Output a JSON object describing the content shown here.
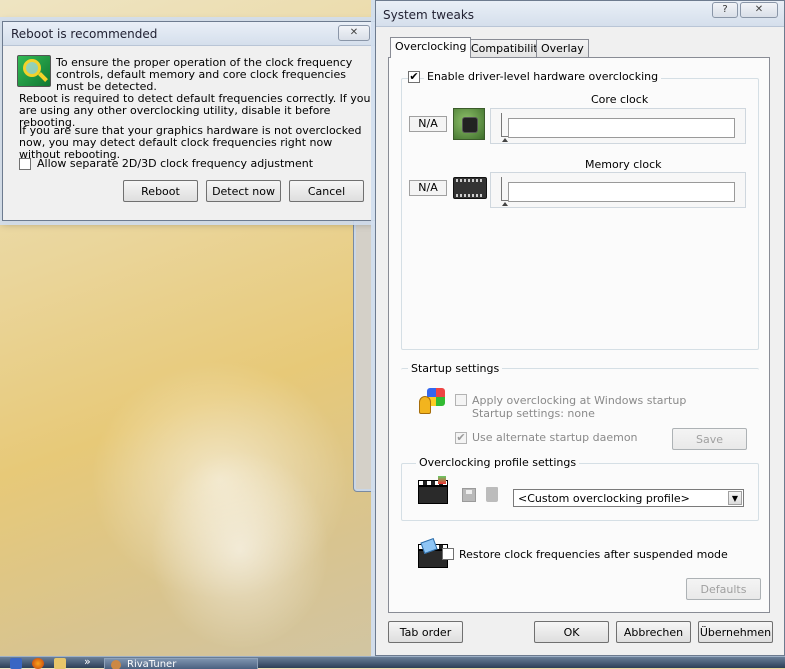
{
  "reboot_dialog": {
    "title": "Reboot is recommended",
    "close_glyph": "✕",
    "intro": "To ensure the proper operation of the clock frequency controls, default memory and core clock frequencies must be detected.",
    "para1": "Reboot is required to detect default frequencies correctly. If you are using any other overclocking utility, disable it before rebooting.",
    "para2": "If you are sure that your graphics hardware  is not overclocked now, you may detect default clock frequencies right now without rebooting.",
    "checkbox_label": "Allow separate 2D/3D clock frequency adjustment",
    "checkbox_checked": false,
    "buttons": {
      "reboot": "Reboot",
      "detect": "Detect now",
      "cancel": "Cancel"
    }
  },
  "system_tweaks": {
    "title": "System tweaks",
    "help_glyph": "?",
    "close_glyph": "✕",
    "tabs": [
      {
        "label": "Overclocking",
        "active": true
      },
      {
        "label": "Compatibility",
        "active": false
      },
      {
        "label": "Overlay",
        "active": false
      }
    ],
    "enable_label": "Enable driver-level hardware overclocking",
    "enable_checked": true,
    "core_clock": {
      "label": "Core clock",
      "value": "N/A",
      "icon": "gpu-chip-icon"
    },
    "memory_clock": {
      "label": "Memory clock",
      "value": "N/A",
      "icon": "memory-chip-icon"
    },
    "startup": {
      "group_label": "Startup settings",
      "apply_label": "Apply overclocking at Windows startup",
      "apply_sub": "Startup settings: none",
      "apply_checked": false,
      "daemon_label": "Use alternate startup daemon",
      "daemon_checked": true,
      "save_label": "Save"
    },
    "profile": {
      "group_label": "Overclocking profile settings",
      "selected": "<Custom overclocking profile>"
    },
    "restore_label": "Restore clock frequencies after suspended mode",
    "restore_checked": false,
    "defaults_label": "Defaults",
    "footer": {
      "tab_order": "Tab order",
      "ok": "OK",
      "cancel": "Abbrechen",
      "apply": "Übernehmen"
    },
    "check_glyph": "✔"
  },
  "taskbar": {
    "item_label": "RivaTuner",
    "overflow_glyph": "»"
  },
  "colors": {
    "title_bar": "#d5dfec",
    "window_bg": "#f0f0f0",
    "panel_bg": "#fbfbfb"
  }
}
